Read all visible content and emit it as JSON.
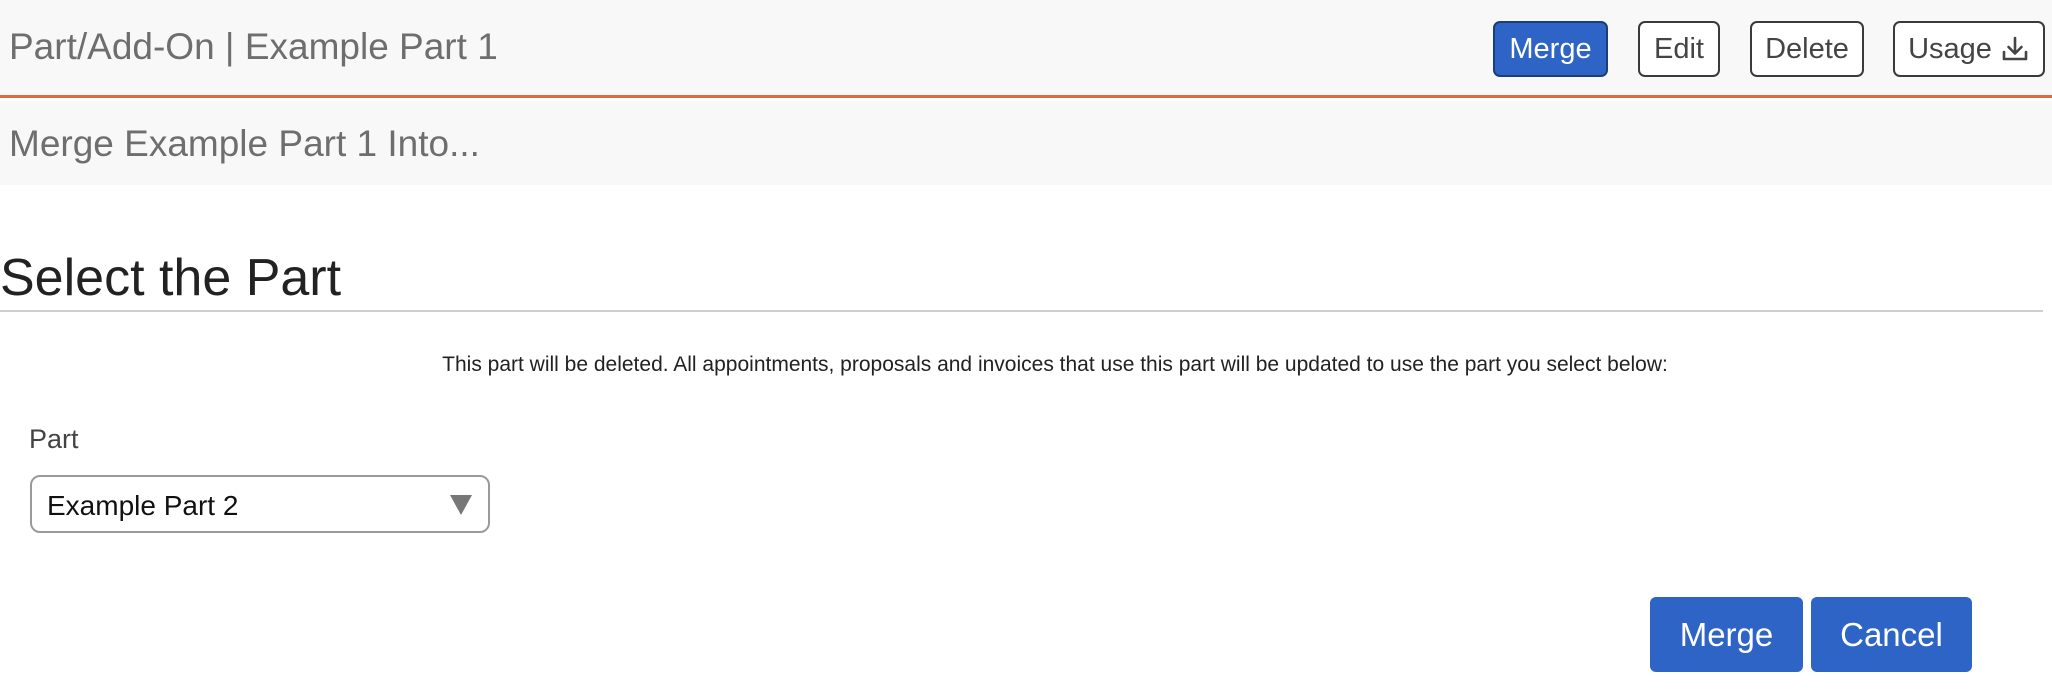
{
  "header": {
    "title": "Part/Add-On | Example Part 1",
    "buttons": {
      "merge": "Merge",
      "edit": "Edit",
      "delete": "Delete",
      "usage": "Usage"
    },
    "usage_icon": "download-icon",
    "accent_color": "#e06a44",
    "primary_color": "#2d64c5"
  },
  "subheader": {
    "title": "Merge Example Part 1 Into..."
  },
  "section": {
    "title": "Select the Part",
    "notice": "This part will be deleted. All appointments, proposals and invoices that use this part will be updated to use the part you select below:"
  },
  "form": {
    "part_label": "Part",
    "part_selected": "Example Part 2",
    "dropdown_icon": "triangle-down-icon"
  },
  "actions": {
    "merge": "Merge",
    "cancel": "Cancel"
  }
}
